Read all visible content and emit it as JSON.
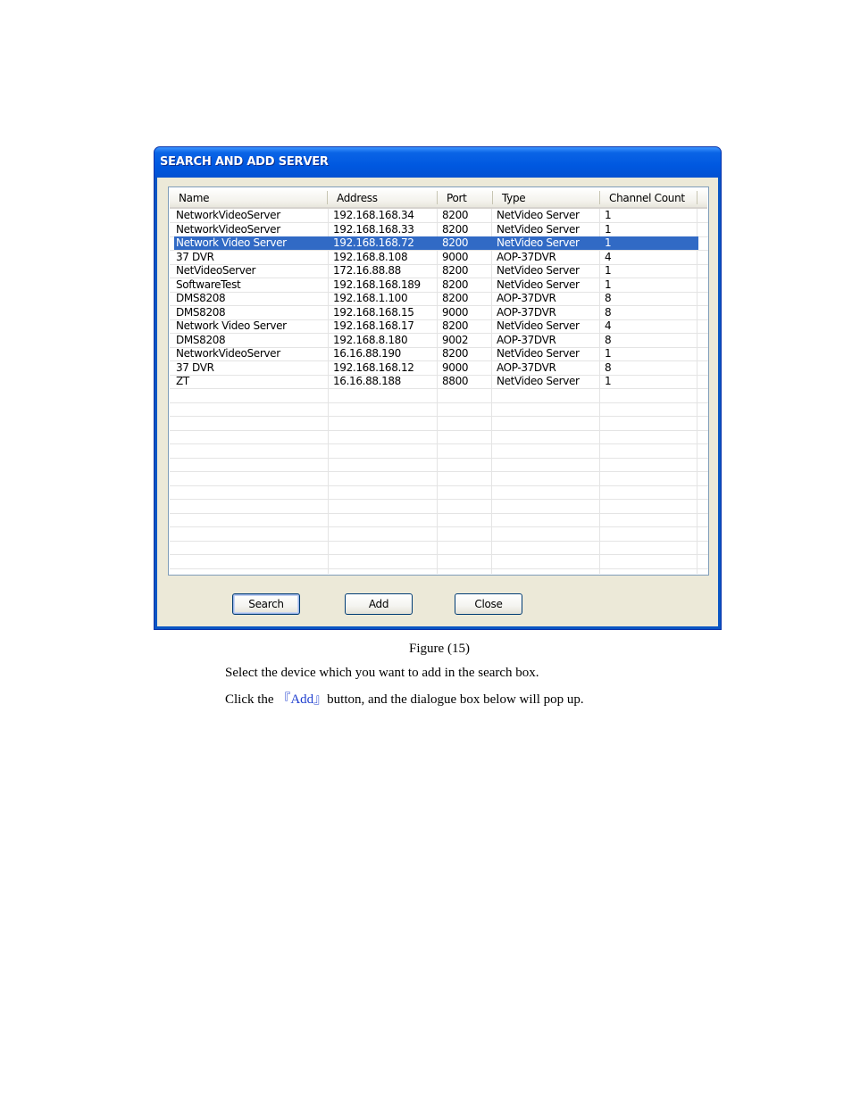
{
  "dialog": {
    "title": "SEARCH AND ADD SERVER",
    "columns": [
      "Name",
      "Address",
      "Port",
      "Type",
      "Channel Count"
    ],
    "rows": [
      [
        "NetworkVideoServer",
        "192.168.168.34",
        "8200",
        "NetVideo Server",
        "1"
      ],
      [
        "NetworkVideoServer",
        "192.168.168.33",
        "8200",
        "NetVideo Server",
        "1"
      ],
      [
        "Network Video Server",
        "192.168.168.72",
        "8200",
        "NetVideo Server",
        "1"
      ],
      [
        "37 DVR",
        "192.168.8.108",
        "9000",
        "AOP-37DVR",
        "4"
      ],
      [
        "NetVideoServer",
        "172.16.88.88",
        "8200",
        "NetVideo Server",
        "1"
      ],
      [
        "SoftwareTest",
        "192.168.168.189",
        "8200",
        "NetVideo Server",
        "1"
      ],
      [
        "DMS8208",
        "192.168.1.100",
        "8200",
        "AOP-37DVR",
        "8"
      ],
      [
        "DMS8208",
        "192.168.168.15",
        "9000",
        "AOP-37DVR",
        "8"
      ],
      [
        "Network Video Server",
        "192.168.168.17",
        "8200",
        "NetVideo Server",
        "4"
      ],
      [
        "DMS8208",
        "192.168.8.180",
        "9002",
        "AOP-37DVR",
        "8"
      ],
      [
        "NetworkVideoServer",
        "16.16.88.190",
        "8200",
        "NetVideo Server",
        "1"
      ],
      [
        "37 DVR",
        "192.168.168.12",
        "9000",
        "AOP-37DVR",
        "8"
      ],
      [
        "ZT",
        "16.16.88.188",
        "8800",
        "NetVideo Server",
        "1"
      ]
    ],
    "selected_row": 2,
    "buttons": {
      "search": "Search",
      "add": "Add",
      "close": "Close"
    },
    "colors": {
      "title_bar": "#0058e0",
      "selection": "#316ac5",
      "face": "#ece9d8"
    }
  },
  "document": {
    "caption": "Figure (15)",
    "line1": "Select the device which you want to add in the search box.",
    "line2_prefix": "Click the ",
    "line2_link": "『Add』",
    "line2_suffix": "button, and the dialogue box below will pop up."
  }
}
